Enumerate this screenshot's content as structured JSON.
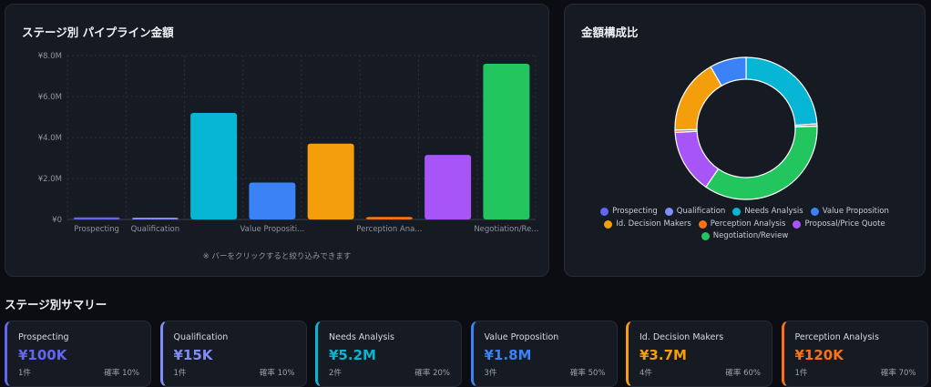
{
  "bar_chart": {
    "title": "ステージ別 パイプライン金額",
    "hint": "※ バーをクリックすると絞り込みできます"
  },
  "donut_chart": {
    "title": "金額構成比"
  },
  "summary": {
    "title": "ステージ別サマリー",
    "cards": [
      {
        "name": "Prospecting",
        "amount": "¥100K",
        "count": "1件",
        "prob": "確率 10%",
        "color": "#6366f1"
      },
      {
        "name": "Qualification",
        "amount": "¥15K",
        "count": "1件",
        "prob": "確率 10%",
        "color": "#818cf8"
      },
      {
        "name": "Needs Analysis",
        "amount": "¥5.2M",
        "count": "2件",
        "prob": "確率 20%",
        "color": "#06b6d4"
      },
      {
        "name": "Value Proposition",
        "amount": "¥1.8M",
        "count": "3件",
        "prob": "確率 50%",
        "color": "#3b82f6"
      },
      {
        "name": "Id. Decision Makers",
        "amount": "¥3.7M",
        "count": "4件",
        "prob": "確率 60%",
        "color": "#f59e0b"
      },
      {
        "name": "Perception Analysis",
        "amount": "¥120K",
        "count": "1件",
        "prob": "確率 70%",
        "color": "#f97316"
      }
    ]
  },
  "chart_data": [
    {
      "type": "bar",
      "title": "ステージ別 パイプライン金額",
      "categories": [
        "Prospecting",
        "Qualification",
        "Needs Analysis",
        "Value Proposition",
        "Id. Decision Makers",
        "Perception Analysis",
        "Proposal/Price Quote",
        "Negotiation/Review"
      ],
      "tick_labels": [
        "Prospecting",
        "Qualification",
        "",
        "Value Propositi...",
        "",
        "Perception Ana...",
        "",
        "Negotiation/Re..."
      ],
      "values": [
        100000,
        15000,
        5200000,
        1800000,
        3700000,
        120000,
        3150000,
        7600000
      ],
      "colors": [
        "#6366f1",
        "#818cf8",
        "#06b6d4",
        "#3b82f6",
        "#f59e0b",
        "#f97316",
        "#a855f7",
        "#22c55e"
      ],
      "ylim": [
        0,
        8000000
      ],
      "yticks": [
        0,
        2000000,
        4000000,
        6000000,
        8000000
      ],
      "ytick_labels": [
        "¥0",
        "¥2.0M",
        "¥4.0M",
        "¥6.0M",
        "¥8.0M"
      ],
      "grid": true
    },
    {
      "type": "pie",
      "title": "金額構成比",
      "labels": [
        "Prospecting",
        "Qualification",
        "Needs Analysis",
        "Value Proposition",
        "Id. Decision Makers",
        "Perception Analysis",
        "Proposal/Price Quote",
        "Negotiation/Review"
      ],
      "values": [
        100000,
        15000,
        5200000,
        1800000,
        3700000,
        120000,
        3150000,
        7600000
      ],
      "colors": [
        "#6366f1",
        "#818cf8",
        "#06b6d4",
        "#3b82f6",
        "#f59e0b",
        "#f97316",
        "#a855f7",
        "#22c55e"
      ],
      "legend": "bottom"
    }
  ]
}
